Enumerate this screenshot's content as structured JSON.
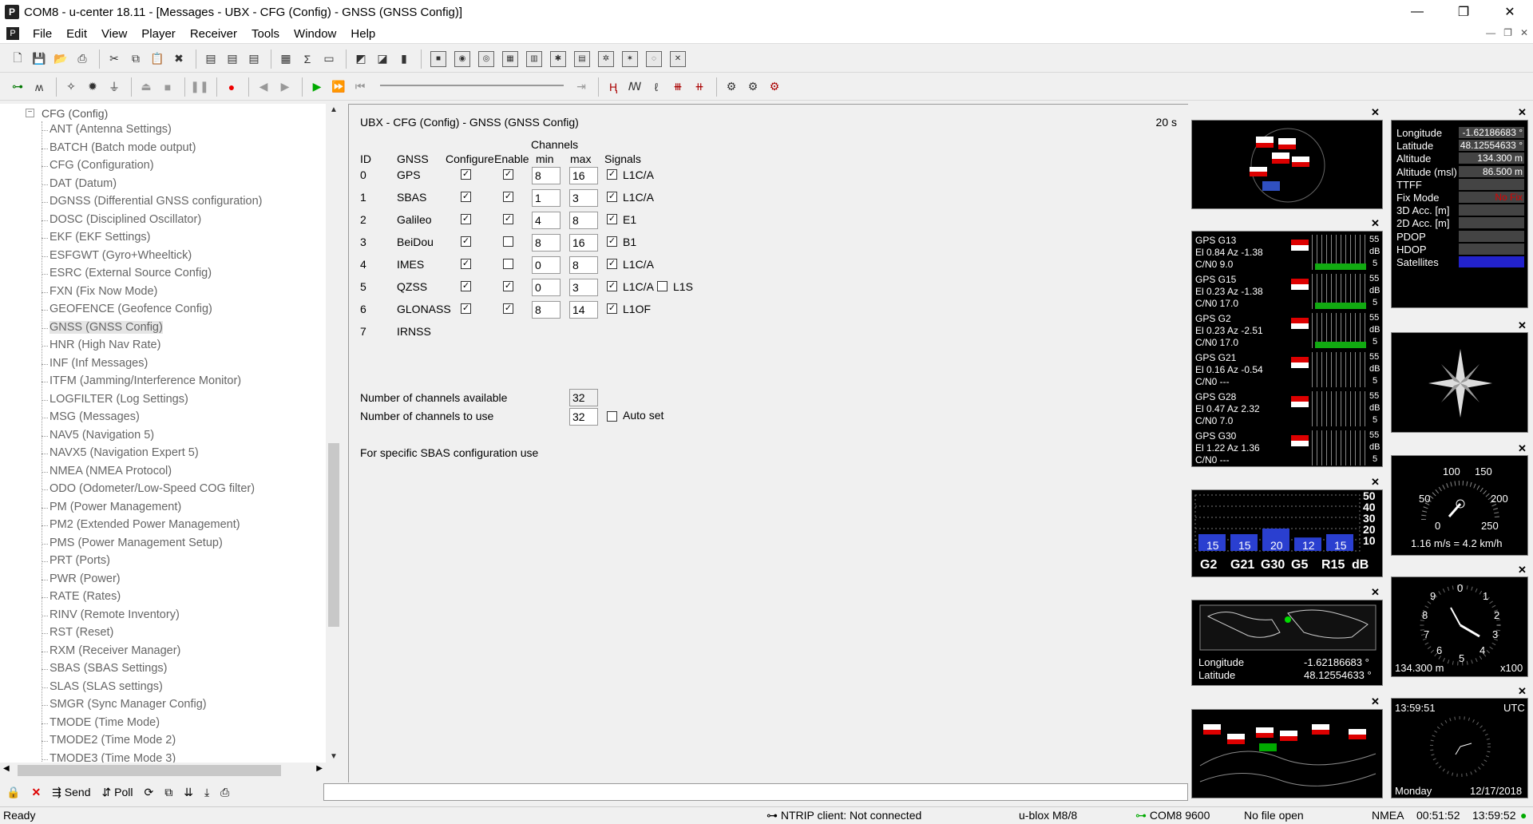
{
  "window": {
    "title": "COM8 - u-center 18.11 - [Messages - UBX - CFG (Config) - GNSS (GNSS Config)]",
    "min": "—",
    "max": "❐",
    "close": "✕"
  },
  "menu": [
    "File",
    "Edit",
    "View",
    "Player",
    "Receiver",
    "Tools",
    "Window",
    "Help"
  ],
  "tree": {
    "root": "CFG (Config)",
    "items": [
      "ANT (Antenna Settings)",
      "BATCH (Batch mode output)",
      "CFG (Configuration)",
      "DAT (Datum)",
      "DGNSS (Differential GNSS configuration)",
      "DOSC (Disciplined Oscillator)",
      "EKF (EKF Settings)",
      "ESFGWT (Gyro+Wheeltick)",
      "ESRC (External Source Config)",
      "FXN (Fix Now Mode)",
      "GEOFENCE (Geofence Config)",
      "GNSS (GNSS Config)",
      "HNR (High Nav Rate)",
      "INF (Inf Messages)",
      "ITFM (Jamming/Interference Monitor)",
      "LOGFILTER (Log Settings)",
      "MSG (Messages)",
      "NAV5 (Navigation 5)",
      "NAVX5 (Navigation Expert 5)",
      "NMEA (NMEA Protocol)",
      "ODO (Odometer/Low-Speed COG filter)",
      "PM (Power Management)",
      "PM2 (Extended Power Management)",
      "PMS (Power Management Setup)",
      "PRT (Ports)",
      "PWR (Power)",
      "RATE (Rates)",
      "RINV (Remote Inventory)",
      "RST (Reset)",
      "RXM (Receiver Manager)",
      "SBAS (SBAS Settings)",
      "SLAS (SLAS settings)",
      "SMGR (Sync Manager Config)",
      "TMODE (Time Mode)",
      "TMODE2 (Time Mode 2)",
      "TMODE3 (Time Mode 3)"
    ]
  },
  "treebar": {
    "send": "Send",
    "poll": "Poll"
  },
  "panel": {
    "header": "UBX - CFG (Config) - GNSS (GNSS Config)",
    "age": "20 s",
    "cols": {
      "id": "ID",
      "gnss": "GNSS",
      "configure": "Configure",
      "enable": "Enable",
      "channels": "Channels",
      "min": "min",
      "max": "max",
      "signals": "Signals"
    },
    "rows": [
      {
        "id": "0",
        "gnss": "GPS",
        "cfg": true,
        "en": true,
        "min": "8",
        "max": "16",
        "sig": "L1C/A"
      },
      {
        "id": "1",
        "gnss": "SBAS",
        "cfg": true,
        "en": true,
        "min": "1",
        "max": "3",
        "sig": "L1C/A"
      },
      {
        "id": "2",
        "gnss": "Galileo",
        "cfg": true,
        "en": true,
        "min": "4",
        "max": "8",
        "sig": "E1"
      },
      {
        "id": "3",
        "gnss": "BeiDou",
        "cfg": true,
        "en": false,
        "min": "8",
        "max": "16",
        "sig": "B1"
      },
      {
        "id": "4",
        "gnss": "IMES",
        "cfg": true,
        "en": false,
        "min": "0",
        "max": "8",
        "sig": "L1C/A"
      },
      {
        "id": "5",
        "gnss": "QZSS",
        "cfg": true,
        "en": true,
        "min": "0",
        "max": "3",
        "sig": "L1C/A",
        "sig2": "L1S"
      },
      {
        "id": "6",
        "gnss": "GLONASS",
        "cfg": true,
        "en": true,
        "min": "8",
        "max": "14",
        "sig": "L1OF"
      },
      {
        "id": "7",
        "gnss": "IRNSS"
      }
    ],
    "avail_label": "Number of channels available",
    "avail_value": "32",
    "use_label": "Number of channels to use",
    "use_value": "32",
    "autoset": "Auto set",
    "sbas_note": "For specific SBAS configuration use"
  },
  "dataview": {
    "labels": [
      "Longitude",
      "Latitude",
      "Altitude",
      "Altitude (msl)",
      "TTFF",
      "Fix Mode",
      "3D Acc. [m]",
      "2D Acc. [m]",
      "PDOP",
      "HDOP",
      "Satellites"
    ],
    "values": [
      "-1.62186683 °",
      "48.12554633 °",
      "134.300 m",
      "86.500 m",
      "",
      "No Fix",
      "",
      "",
      "",
      "",
      ""
    ]
  },
  "signals": [
    {
      "name": "GPS G13",
      "info": "El 0.84 Az -1.38",
      "cn": "C/N0 9.0"
    },
    {
      "name": "GPS G15",
      "info": "El 0.23 Az -1.38",
      "cn": "C/N0 17.0"
    },
    {
      "name": "GPS G2",
      "info": "El 0.23 Az -2.51",
      "cn": "C/N0 17.0"
    },
    {
      "name": "GPS G21",
      "info": "El 0.16 Az -0.54",
      "cn": "C/N0 ---"
    },
    {
      "name": "GPS G28",
      "info": "El 0.47 Az 2.32",
      "cn": "C/N0 7.0"
    },
    {
      "name": "GPS G30",
      "info": "El 1.22 Az 1.36",
      "cn": "C/N0 ---"
    }
  ],
  "scale": {
    "top": "55",
    "unit": "dB",
    "bottom": "5"
  },
  "bars": {
    "labels": [
      "G2",
      "G21",
      "G30",
      "G5",
      "R15",
      "dB"
    ],
    "values": [
      "15",
      "15",
      "20",
      "12",
      "15"
    ],
    "axis": [
      "50",
      "40",
      "30",
      "20",
      "10"
    ]
  },
  "worldmap": {
    "lon_label": "Longitude",
    "lon": "-1.62186683 °",
    "lat_label": "Latitude",
    "lat": "48.12554633 °"
  },
  "speed": {
    "t1": "100",
    "t2": "150",
    "t3": "50",
    "t4": "200",
    "t5": "0",
    "t6": "250",
    "text": "1.16 m/s = 4.2 km/h"
  },
  "alt": {
    "n0": "0",
    "n1": "1",
    "n9": "9",
    "n8": "8",
    "n2": "2",
    "n7": "7",
    "n3": "3",
    "n6": "6",
    "n4": "4",
    "n5": "5",
    "value": "134.300 m",
    "mult": "x100"
  },
  "clock": {
    "time": "13:59:51",
    "zone": "UTC",
    "day": "Monday",
    "date": "12/17/2018"
  },
  "status": {
    "ready": "Ready",
    "ntrip": "NTRIP client: Not connected",
    "rx": "u-blox M8/8",
    "port": "COM8 9600",
    "file": "No file open",
    "proto": "NMEA",
    "t1": "00:51:52",
    "t2": "13:59:52"
  }
}
